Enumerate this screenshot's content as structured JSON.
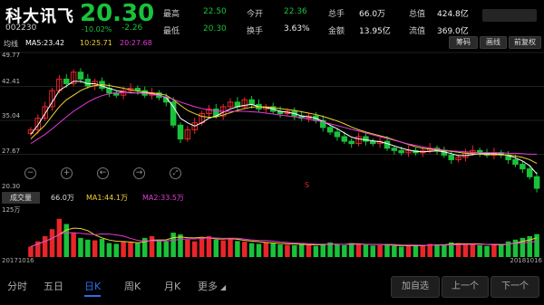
{
  "stock": {
    "name": "科大讯飞",
    "code": "002230",
    "price": "20.30",
    "pct": "-10.02%",
    "change": "-2.26"
  },
  "quote": [
    {
      "label": "最高",
      "value": "22.50"
    },
    {
      "label": "今开",
      "value": "22.36"
    },
    {
      "label": "总手",
      "value": "66.0万"
    },
    {
      "label": "总值",
      "value": "424.8亿"
    },
    {
      "label": "最低",
      "value": "20.30"
    },
    {
      "label": "换手",
      "value": "3.63%"
    },
    {
      "label": "金额",
      "value": "13.95亿"
    },
    {
      "label": "流值",
      "value": "369.0亿"
    }
  ],
  "ma": {
    "label": "均线",
    "ma5": "MA5:23.42",
    "ma10": "10:25.71",
    "ma20": "20:27.68"
  },
  "buttons": {
    "chips": "筹码",
    "draw": "画线",
    "adjust": "前复权"
  },
  "yaxis": [
    "49.77",
    "42.41",
    "35.04",
    "27.67",
    "20.30"
  ],
  "volume": {
    "tab": "成交量",
    "value": "66.0万",
    "ma1": "MA1:44.1万",
    "ma2": "MA2:33.5万",
    "max": "125万"
  },
  "dates": {
    "start": "20171016",
    "end": "20181016"
  },
  "marker": "S",
  "tabs": [
    "分时",
    "五日",
    "日K",
    "周K",
    "月K",
    "更多"
  ],
  "active_tab": "日K",
  "actions": {
    "add": "加自选",
    "prev": "上一个",
    "next": "下一个"
  },
  "colors": {
    "up": "#e8262a",
    "down": "#19c23a",
    "ma5": "#ffffff",
    "ma10": "#f2d22e",
    "ma20": "#e23ad8",
    "accent": "#2d6ee8"
  },
  "chart_data": {
    "type": "candlestick",
    "ylim": [
      20.3,
      49.77
    ],
    "closes": [
      33.0,
      35.5,
      38.0,
      41.5,
      44.0,
      43.0,
      45.5,
      44.0,
      42.5,
      43.5,
      42.0,
      41.0,
      40.5,
      41.5,
      42.0,
      41.5,
      40.5,
      41.0,
      40.0,
      39.0,
      34.0,
      31.0,
      33.0,
      34.5,
      36.5,
      37.5,
      36.0,
      38.0,
      39.0,
      38.0,
      39.5,
      38.5,
      37.5,
      38.0,
      37.0,
      36.5,
      37.0,
      36.0,
      35.5,
      36.0,
      35.0,
      33.5,
      32.5,
      31.5,
      30.5,
      30.0,
      31.5,
      30.5,
      30.0,
      30.5,
      29.0,
      28.5,
      28.0,
      28.5,
      28.0,
      28.5,
      29.0,
      28.5,
      27.5,
      26.5,
      27.0,
      28.0,
      28.5,
      28.0,
      27.5,
      28.0,
      27.5,
      26.5,
      25.5,
      24.5,
      22.8,
      20.3
    ],
    "volumes": [
      30,
      45,
      60,
      80,
      110,
      95,
      70,
      55,
      50,
      48,
      52,
      40,
      38,
      45,
      42,
      40,
      55,
      60,
      48,
      45,
      70,
      65,
      50,
      45,
      55,
      60,
      50,
      48,
      52,
      46,
      44,
      40,
      38,
      42,
      40,
      36,
      35,
      34,
      38,
      36,
      32,
      38,
      42,
      36,
      34,
      40,
      38,
      35,
      33,
      34,
      36,
      32,
      30,
      33,
      35,
      34,
      38,
      36,
      34,
      42,
      40,
      38,
      36,
      34,
      32,
      38,
      36,
      45,
      50,
      55,
      60,
      66
    ],
    "ma5": [
      32.0,
      34.0,
      36.5,
      39.0,
      41.5,
      42.5,
      43.5,
      43.5,
      43.0,
      43.0,
      42.5,
      42.0,
      41.5,
      41.2,
      41.0,
      41.0,
      41.0,
      40.8,
      40.5,
      40.0,
      38.0,
      35.5,
      34.5,
      33.8,
      34.5,
      35.5,
      36.0,
      36.8,
      37.5,
      38.0,
      38.3,
      38.5,
      38.0,
      37.8,
      37.5,
      37.0,
      36.8,
      36.5,
      36.0,
      35.8,
      35.5,
      34.8,
      34.0,
      33.2,
      32.3,
      31.4,
      31.0,
      30.8,
      30.6,
      30.4,
      30.0,
      29.5,
      29.0,
      28.6,
      28.3,
      28.2,
      28.3,
      28.4,
      28.2,
      27.8,
      27.4,
      27.4,
      27.6,
      27.8,
      27.8,
      27.8,
      27.7,
      27.4,
      26.9,
      26.2,
      25.2,
      23.4
    ],
    "ma10": [
      31.0,
      32.5,
      34.0,
      36.0,
      38.0,
      39.5,
      40.5,
      41.5,
      42.2,
      42.6,
      42.8,
      42.6,
      42.3,
      42.0,
      41.7,
      41.4,
      41.2,
      41.0,
      40.8,
      40.5,
      39.5,
      38.3,
      37.2,
      36.5,
      35.9,
      35.7,
      35.8,
      36.2,
      36.7,
      37.2,
      37.6,
      37.9,
      38.0,
      37.9,
      37.8,
      37.6,
      37.4,
      37.2,
      36.9,
      36.6,
      36.3,
      35.9,
      35.4,
      34.9,
      34.3,
      33.6,
      33.0,
      32.5,
      32.1,
      31.7,
      31.3,
      30.8,
      30.3,
      29.8,
      29.3,
      29.0,
      28.8,
      28.6,
      28.5,
      28.3,
      28.1,
      27.9,
      27.8,
      27.7,
      27.6,
      27.6,
      27.6,
      27.5,
      27.3,
      27.0,
      26.5,
      25.7
    ],
    "ma20": [
      30.0,
      31.0,
      32.0,
      33.2,
      34.5,
      35.8,
      37.0,
      38.0,
      39.0,
      39.8,
      40.4,
      40.8,
      41.0,
      41.1,
      41.1,
      41.0,
      40.9,
      40.7,
      40.4,
      40.1,
      39.6,
      39.0,
      38.5,
      38.0,
      37.6,
      37.3,
      37.1,
      37.0,
      37.0,
      37.0,
      37.0,
      36.9,
      36.8,
      36.6,
      36.4,
      36.2,
      36.0,
      35.8,
      35.6,
      35.3,
      35.0,
      34.7,
      34.3,
      33.9,
      33.5,
      33.1,
      32.7,
      32.3,
      31.9,
      31.5,
      31.1,
      30.7,
      30.3,
      29.9,
      29.6,
      29.3,
      29.0,
      28.8,
      28.6,
      28.4,
      28.3,
      28.2,
      28.1,
      28.0,
      28.0,
      28.0,
      28.0,
      27.9,
      27.9,
      27.8,
      27.7,
      27.7
    ]
  }
}
